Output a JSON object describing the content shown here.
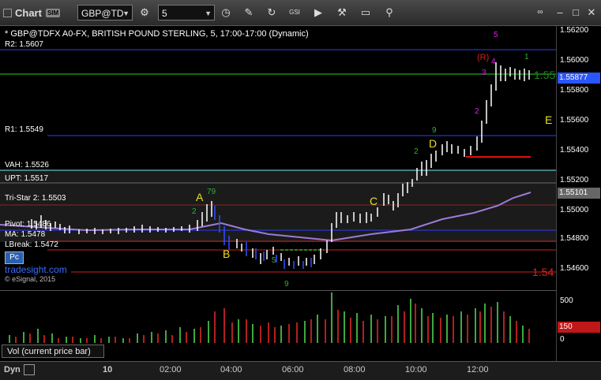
{
  "toolbar": {
    "title": "Chart",
    "sim_badge": "SIM",
    "symbol": "GBP@TD",
    "interval": "5",
    "icons": [
      "gear-icon",
      "clock-icon",
      "pencil-icon",
      "refresh-icon",
      "gsi-icon",
      "play-icon",
      "wrench-icon",
      "comment-icon",
      "pin-icon",
      "link-icon"
    ]
  },
  "chart": {
    "header": "* GBP@TDFX A0-FX, BRITISH POUND STERLING, 5, 17:00-17:00 (Dynamic)",
    "levels": [
      {
        "label": "R2: 1.5607",
        "color": "#3a3aff"
      },
      {
        "label": "R1: 1.5549",
        "color": "#3a3aff"
      },
      {
        "label": "VAH: 1.5526",
        "color": "#6fe0e0"
      },
      {
        "label": "UPT: 1.5517",
        "color": "#ffffff"
      },
      {
        "label": "Tri-Star 2: 1.5503",
        "color": "#ffffff"
      },
      {
        "label": "Pivot: 1.5486",
        "color": "#ffffff"
      },
      {
        "label": "MA: 1.5478",
        "color": "#ffffff"
      },
      {
        "label": "LBreak: 1.5472",
        "color": "#ffffff"
      }
    ],
    "markers": {
      "A": "A",
      "B": "B",
      "C": "C",
      "D": "D",
      "E": "E",
      "R": "(R)"
    },
    "watermark": "tradesight.com",
    "copyright": "© eSignal, 2015",
    "pc_button": "Pc",
    "green_level": "1.55",
    "red_level": "1.54"
  },
  "price_axis": {
    "ticks": [
      "1.56200",
      "1.56000",
      "1.55800",
      "1.55600",
      "1.55400",
      "1.55200",
      "1.55000",
      "1.54800",
      "1.54600"
    ],
    "current_price": "1.55877",
    "ma_price": "1.55101"
  },
  "volume": {
    "label": "Vol (current price bar)",
    "ticks": [
      "500",
      "0"
    ],
    "current": "150"
  },
  "time_axis": {
    "labels": [
      "10",
      "02:00",
      "04:00",
      "06:00",
      "08:00",
      "10:00",
      "12:00"
    ],
    "dyn_label": "Dyn"
  },
  "colors": {
    "background": "#000000",
    "up_bar": "#ffffff",
    "down_bar": "#3050ff",
    "ma_line": "#9c7ad8",
    "vol_up": "#3fa83f",
    "vol_down": "#b02020"
  }
}
